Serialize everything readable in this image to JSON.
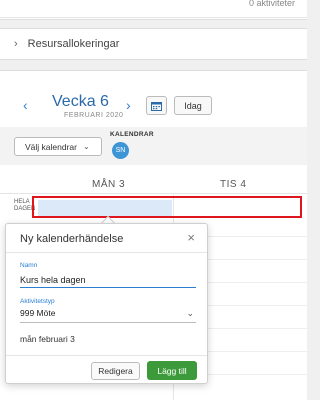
{
  "top_card": {
    "activities_text": "0 aktiviteter"
  },
  "resource_section": {
    "label": "Resursallokeringar"
  },
  "week_nav": {
    "title": "Vecka 6",
    "subtitle": "FEBRUARI 2020",
    "today_label": "Idag"
  },
  "calendar_bar": {
    "select_label": "Välj kalendrar",
    "calendars_heading": "KALENDRAR",
    "avatar_initials": "SN"
  },
  "days": {
    "monday": "MÅN 3",
    "tuesday": "TIS 4"
  },
  "all_day_label": [
    "HELA",
    "DAGEN"
  ],
  "popup": {
    "title": "Ny kalenderhändelse",
    "name_label": "Namn",
    "name_value": "Kurs hela dagen",
    "activity_type_label": "Aktivitetstyp",
    "activity_type_value": "999 Möte",
    "date_text": "mån februari 3",
    "edit_label": "Redigera",
    "add_label": "Lägg till"
  },
  "colors": {
    "accent": "#2b7fd3",
    "add_button": "#3c9a3a",
    "highlight": "#e0161e",
    "event_fill": "#dbe9f8"
  }
}
